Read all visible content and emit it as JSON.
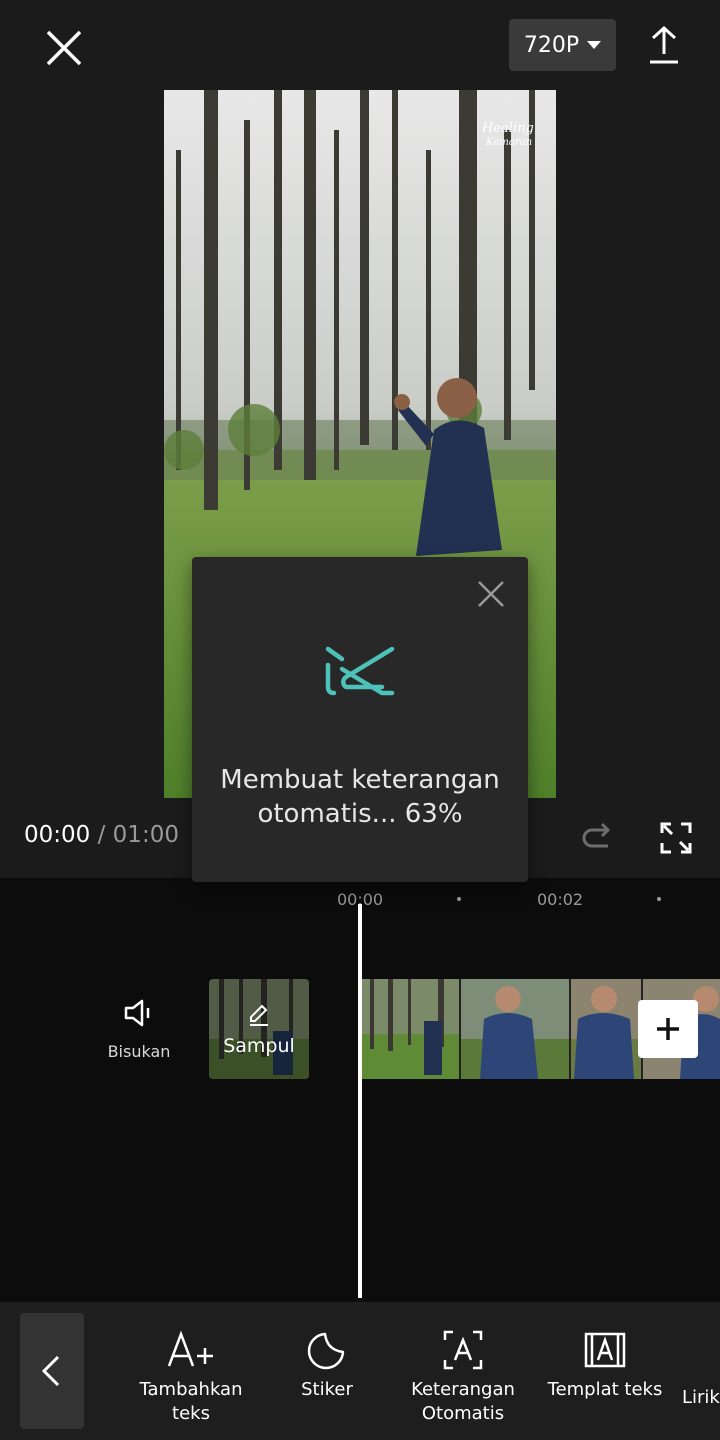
{
  "top_bar": {
    "resolution": "720P",
    "close_icon": "close-icon",
    "export_icon": "export-icon"
  },
  "player": {
    "current_time": "00:00",
    "separator": "/",
    "total_time": "01:00"
  },
  "dialog": {
    "message": "Membuat keterangan otomatis... 63%",
    "progress_percent": 63,
    "logo_icon": "capcut-logo",
    "accent_color": "#4ec2b8"
  },
  "timeline": {
    "ticks": [
      "00:00",
      "00:02"
    ],
    "mute_label": "Bisukan",
    "cover_label": "Sampul"
  },
  "toolbar": {
    "items": [
      {
        "label": "Tambahkan teks",
        "icon": "add-text-icon"
      },
      {
        "label": "Stiker",
        "icon": "sticker-icon"
      },
      {
        "label": "Keterangan Otomatis",
        "icon": "auto-caption-icon"
      },
      {
        "label": "Templat teks",
        "icon": "text-template-icon"
      },
      {
        "label": "Lirik",
        "icon": "lyrics-icon"
      }
    ]
  },
  "colors": {
    "background": "#1b1b1b",
    "timeline": "#0c0c0c",
    "toolbar": "#1e1e1e",
    "accent": "#4ec2b8"
  }
}
